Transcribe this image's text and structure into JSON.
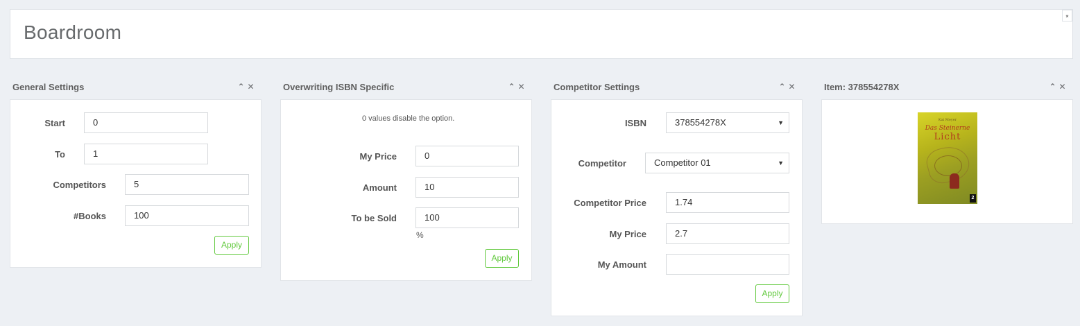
{
  "page": {
    "title": "Boardroom",
    "collapse_glyph": "⌅"
  },
  "icons": {
    "collapse": "chevron-up-icon",
    "close": "close-icon"
  },
  "general": {
    "title": "General Settings",
    "start_label": "Start",
    "start_value": "0",
    "to_label": "To",
    "to_value": "1",
    "competitors_label": "Competitors",
    "competitors_value": "5",
    "books_label": "#Books",
    "books_value": "100",
    "apply": "Apply"
  },
  "isbn_specific": {
    "title": "Overwriting ISBN Specific",
    "note": "0 values disable the option.",
    "price_label": "My Price",
    "price_value": "0",
    "amount_label": "Amount",
    "amount_value": "10",
    "sold_label": "To be Sold",
    "sold_value": "100",
    "percent": "%",
    "apply": "Apply"
  },
  "competitor": {
    "title": "Competitor Settings",
    "isbn_label": "ISBN",
    "isbn_value": "378554278X",
    "competitor_label": "Competitor",
    "competitor_value": "Competitor 01",
    "comp_price_label": "Competitor Price",
    "comp_price_value": "1.74",
    "my_price_label": "My Price",
    "my_price_value": "2.7",
    "my_amount_label": "My Amount",
    "my_amount_value": "",
    "apply": "Apply"
  },
  "item": {
    "title": "Item: 378554278X",
    "cover": {
      "author": "Kai Meyer",
      "title_line1": "Das Steinerne",
      "title_line2": "Licht",
      "logo": "2"
    }
  },
  "colors": {
    "accent": "#61c93d",
    "background": "#edf0f4"
  }
}
